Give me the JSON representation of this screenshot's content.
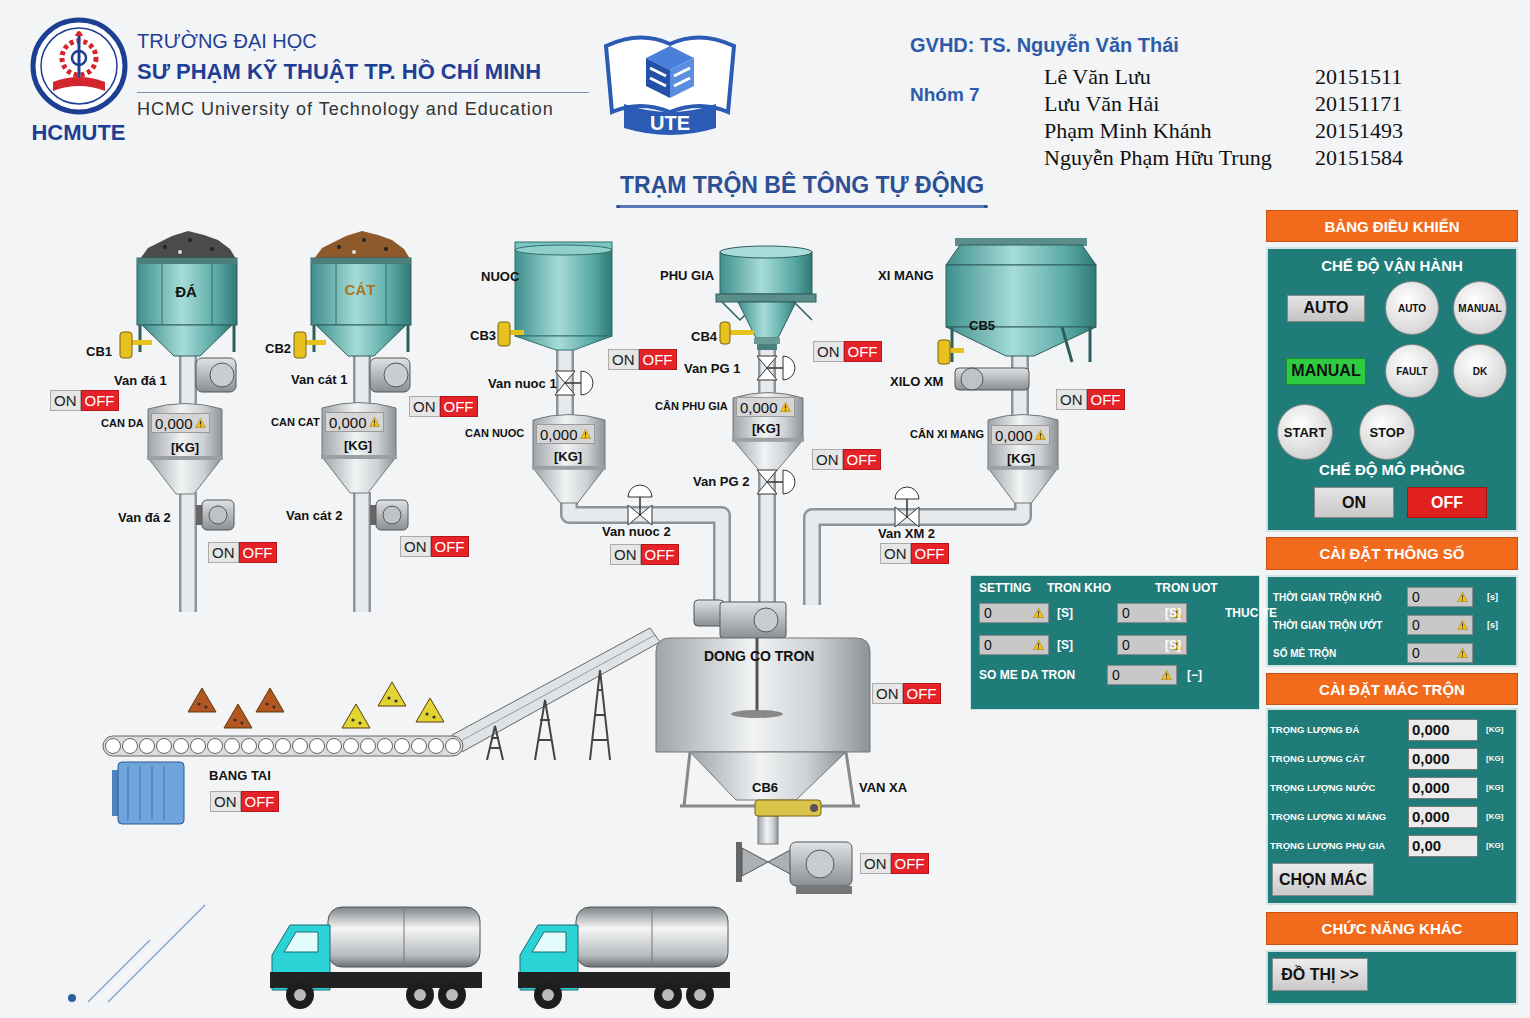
{
  "header": {
    "logo_text": "HCMUTE",
    "school": [
      "TRƯỜNG ĐẠI HỌC",
      "SƯ PHẠM KỸ THUẬT TP. HỒ CHÍ MINH",
      "HCMC University of Technology and Education"
    ],
    "badge": "UTE",
    "advisor": "GVHD: TS. Nguyễn Văn Thái",
    "group": "Nhóm 7",
    "members": [
      {
        "name": "Lê Văn Lưu",
        "id": "20151511"
      },
      {
        "name": "Lưu Văn Hải",
        "id": "20151171"
      },
      {
        "name": "Phạm Minh Khánh",
        "id": "20151493"
      },
      {
        "name": "Nguyễn Phạm Hữu Trung",
        "id": "20151584"
      }
    ]
  },
  "title": "TRẠM TRỘN BÊ TÔNG TỰ ĐỘNG",
  "diagram": {
    "units": [
      {
        "kind": "bin",
        "name": "ĐÁ",
        "sensor": "CB1",
        "feeder": "Van đá 1",
        "feeder_switch": {
          "on_label": "ON",
          "off_label": "OFF",
          "on": false
        },
        "scale": {
          "label": "CAN DA",
          "value": "0,000",
          "unit": "[KG]"
        },
        "outlet": "Van đá 2",
        "outlet_switch": {
          "on_label": "ON",
          "off_label": "OFF",
          "on": false
        }
      },
      {
        "kind": "bin",
        "name": "CÁT",
        "sensor": "CB2",
        "feeder": "Van cát 1",
        "feeder_switch": {
          "on_label": "ON",
          "off_label": "OFF",
          "on": false
        },
        "scale": {
          "label": "CAN CAT",
          "value": "0,000",
          "unit": "[KG]"
        },
        "outlet": "Van cát 2",
        "outlet_switch": {
          "on_label": "ON",
          "off_label": "OFF",
          "on": false
        }
      },
      {
        "kind": "tank",
        "name": "NUOC",
        "sensor": "CB3",
        "feeder": "Van nuoc 1",
        "feeder_switch": {
          "on_label": "ON",
          "off_label": "OFF",
          "on": false
        },
        "scale": {
          "label": "CAN NUOC",
          "value": "0,000",
          "unit": "[KG]"
        },
        "outlet": "Van nuoc 2",
        "outlet_switch": {
          "on_label": "ON",
          "off_label": "OFF",
          "on": false
        }
      },
      {
        "kind": "hopper",
        "name": "PHU GIA",
        "sensor": "CB4",
        "feeder": "Van PG 1",
        "feeder_switch": {
          "on_label": "ON",
          "off_label": "OFF",
          "on": false
        },
        "scale": {
          "label": "CÂN PHU GIA",
          "value": "0,000",
          "unit": "[KG]"
        },
        "outlet": "Van PG 2",
        "outlet_switch": {
          "on_label": "ON",
          "off_label": "OFF",
          "on": false
        }
      },
      {
        "kind": "silo",
        "name": "XI MANG",
        "sensor": "CB5",
        "feeder": "XILO XM",
        "feeder_switch": {
          "on_label": "ON",
          "off_label": "OFF",
          "on": false
        },
        "scale": {
          "label": "CÂN XI MANG",
          "value": "0,000",
          "unit": "[KG]"
        },
        "outlet": "Van XM 2",
        "outlet_switch": {
          "on_label": "ON",
          "off_label": "OFF",
          "on": false
        }
      }
    ],
    "mixer": {
      "motor": "DONG CO TRON",
      "motor_switch": {
        "on_label": "ON",
        "off_label": "OFF",
        "on": false
      },
      "sensor": "CB6",
      "discharge": "VAN XA",
      "discharge_switch": {
        "on_label": "ON",
        "off_label": "OFF",
        "on": false
      }
    },
    "conveyor": {
      "label": "BANG TAI",
      "switch": {
        "on_label": "ON",
        "off_label": "OFF",
        "on": false
      }
    }
  },
  "timing": {
    "columns": [
      "TRON KHO",
      "TRON UOT"
    ],
    "rows": [
      {
        "label": "SETTING",
        "values": [
          "0",
          "0"
        ],
        "unit": "[S]"
      },
      {
        "label": "THUC TE",
        "values": [
          "0",
          "0"
        ],
        "unit": "[S]"
      }
    ],
    "batches": {
      "label": "SO ME DA TRON",
      "value": "0",
      "unit": "[−]"
    }
  },
  "control": {
    "title": "BẢNG ĐIỀU KHIỂN",
    "mode_title": "CHẾ ĐỘ VẬN HÀNH",
    "mode_buttons": [
      {
        "label": "AUTO",
        "selected": false
      },
      {
        "label": "MANUAL",
        "selected": true
      }
    ],
    "lamps": [
      {
        "label": "AUTO",
        "lit": false
      },
      {
        "label": "MANUAL",
        "lit": false
      },
      {
        "label": "FAULT",
        "lit": false
      },
      {
        "label": "DK",
        "lit": false
      }
    ],
    "actions": [
      "START",
      "STOP"
    ],
    "sim_title": "CHẾ ĐỘ MÔ PHỎNG",
    "sim_buttons": [
      {
        "label": "ON",
        "selected": false
      },
      {
        "label": "OFF",
        "selected": true
      }
    ]
  },
  "params": {
    "title": "CÀI ĐẶT THÔNG SỐ",
    "fields": [
      {
        "label": "THỜI GIAN TRỘN KHÔ",
        "value": "0",
        "unit": "[s]"
      },
      {
        "label": "THỜI GIAN TRỘN ƯỚT",
        "value": "0",
        "unit": "[s]"
      },
      {
        "label": "SỐ MẺ TRỘN",
        "value": "0",
        "unit": ""
      }
    ]
  },
  "recipe": {
    "title": "CÀI ĐẶT MÁC TRỘN",
    "fields": [
      {
        "label": "TRỌNG LƯỢNG ĐÁ",
        "value": "0,000",
        "unit": "[KG]"
      },
      {
        "label": "TRỌNG LƯỢNG CÁT",
        "value": "0,000",
        "unit": "[KG]"
      },
      {
        "label": "TRỌNG LƯỢNG NƯỚC",
        "value": "0,000",
        "unit": "[KG]"
      },
      {
        "label": "TRỌNG LƯỢNG XI MĂNG",
        "value": "0,000",
        "unit": "[KG]"
      },
      {
        "label": "TRỌNG LƯỢNG PHỤ GIA",
        "value": "0,00",
        "unit": "[KG]"
      }
    ],
    "button": "CHỌN MÁC"
  },
  "other": {
    "title": "CHỨC NĂNG KHÁC",
    "button": "ĐỒ THỊ >>"
  }
}
